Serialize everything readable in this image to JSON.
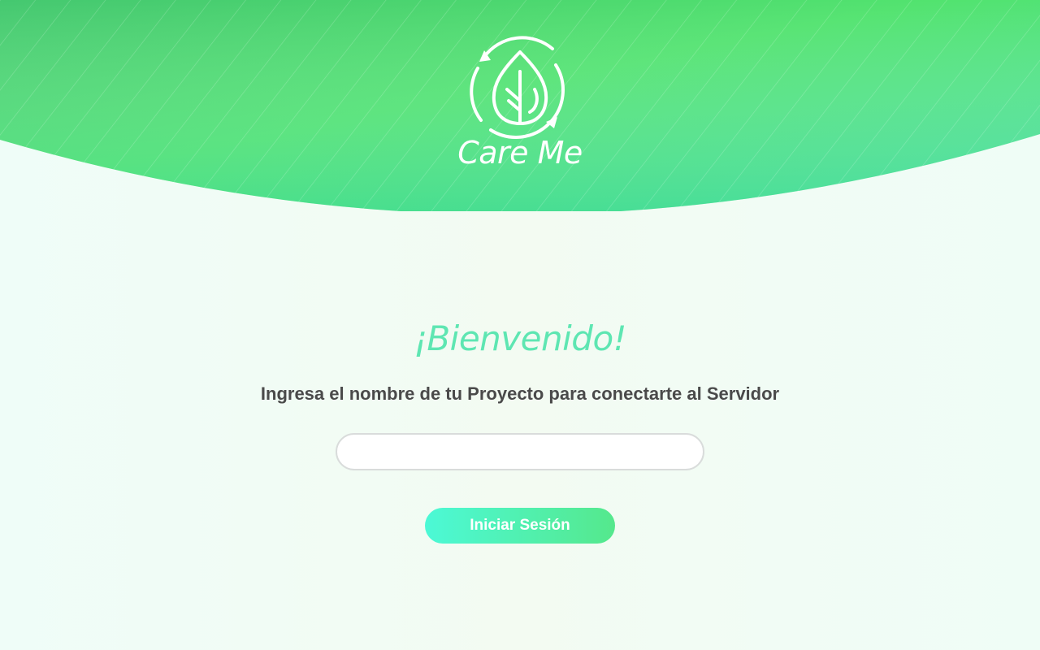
{
  "header": {
    "brand_name": "Care Me",
    "logo_icon": "leaf-drop-recycle-icon",
    "gradient_colors": [
      "#45c870",
      "#52e36f",
      "#4ee0a2"
    ]
  },
  "main": {
    "welcome_title": "¡Bienvenido!",
    "instruction": "Ingresa el nombre de tu Proyecto para conectarte al Servidor",
    "project_input": {
      "value": "",
      "placeholder": ""
    },
    "login_button_label": "Iniciar Sesión"
  },
  "colors": {
    "accent": "#5ee6b2",
    "button_start": "#4cf9d6",
    "button_end": "#55e88c",
    "text": "#4a4a4a"
  }
}
